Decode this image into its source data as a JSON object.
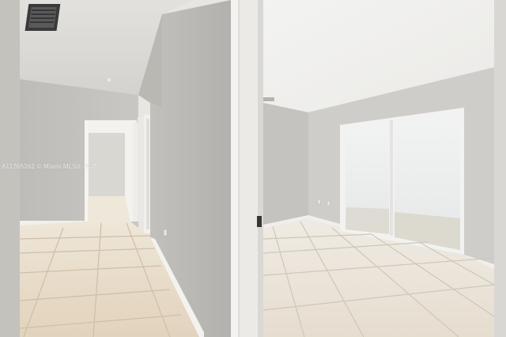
{
  "photo": {
    "watermark": "A11765262 © Miami MLS® 2025",
    "colors": {
      "wall": "#c9c6c0",
      "wall_shadow": "#aeaba5",
      "ceiling": "#f1f0ee",
      "floor_tile": "#e8dcc8",
      "grout": "#cbbfa9",
      "trim": "#f3f2f0",
      "glass": "#eef0f0"
    }
  }
}
